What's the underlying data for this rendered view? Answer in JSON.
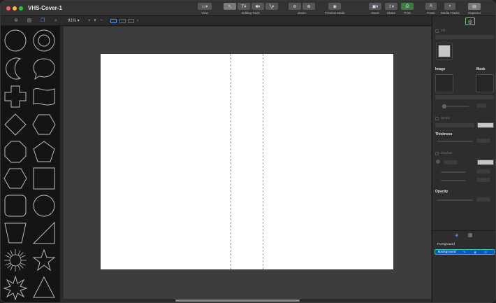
{
  "window": {
    "title": "VHS-Cover-1"
  },
  "toolbar": {
    "view_label": "View",
    "editing_tools_label": "Editing Tools",
    "zoom_label": "Zoom",
    "preview_mode_label": "Preview Mode",
    "insert_label": "Insert",
    "share_label": "Share",
    "print_label": "Print",
    "fonts_label": "Fonts",
    "media_tracks_label": "Media Tracks",
    "inspector_label": "Inspector"
  },
  "subbar": {
    "zoom_value": "91%"
  },
  "inspector": {
    "fill_label": "Fill",
    "image_label": "Image",
    "mask_label": "Mask",
    "stroke_label": "Stroke",
    "thickness_label": "Thickness",
    "shadow_label": "Shadow",
    "opacity_label": "Opacity"
  },
  "layers": {
    "items": [
      {
        "label": "Foreground",
        "selected": false
      },
      {
        "label": "Background",
        "selected": true
      }
    ]
  },
  "colors": {
    "accent_selection": "#0a5ac4",
    "active_outline": "#6ad26a",
    "canvas_bg": "#3d3d3d",
    "page_bg": "#ffffff"
  },
  "shapes_library": {
    "shapes": [
      "circle",
      "ring",
      "crescent",
      "speech-bubble",
      "cross",
      "flag",
      "diamond",
      "hexagon",
      "octagon",
      "pentagon",
      "hexagon-flat",
      "square",
      "rounded-square",
      "circle-large",
      "trapezoid",
      "right-triangle",
      "starburst",
      "star",
      "star-8",
      "triangle"
    ]
  }
}
